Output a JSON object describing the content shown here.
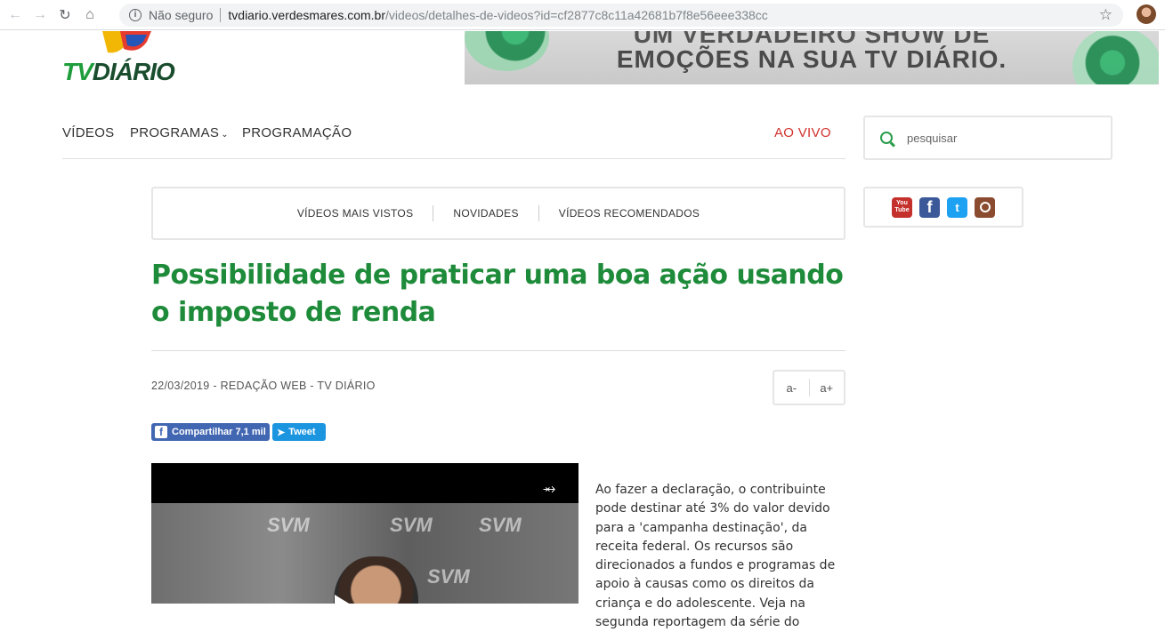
{
  "browser": {
    "security_label": "Não seguro",
    "url_host": "tvdiario.verdesmares.com.br",
    "url_path": "/videos/detalhes-de-videos?id=cf2877c8c11a42681b7f8e56eee338cc"
  },
  "logo": {
    "tv": "TV",
    "diario": "DIÁRIO"
  },
  "banner": {
    "line1": "UM VERDADEIRO SHOW DE",
    "line2": "EMOÇÕES NA SUA TV DIÁRIO."
  },
  "nav": {
    "videos": "VÍDEOS",
    "programas": "PROGRAMAS",
    "programacao": "PROGRAMAÇÃO",
    "ao_vivo": "AO VIVO"
  },
  "search": {
    "placeholder": "pesquisar"
  },
  "subnav": {
    "mais_vistos": "VÍDEOS MAIS VISTOS",
    "novidades": "NOVIDADES",
    "recomendados": "VÍDEOS RECOMENDADOS"
  },
  "social": {
    "youtube": "You Tube",
    "facebook": "f",
    "twitter": "t"
  },
  "article": {
    "title": "Possibilidade de praticar uma boa ação usando o imposto de renda",
    "byline": "22/03/2019 - REDAÇÃO WEB - TV DIÁRIO",
    "font_minus": "a-",
    "font_plus": "a+",
    "share_label": "Compartilhar 7,1 mil",
    "tweet_label": "Tweet",
    "body": "Ao fazer a declaração, o contribuinte pode destinar até 3% do valor devido para a 'campanha destinação', da receita federal. Os recursos são direcionados a fundos e programas de apoio à causas como os direitos da criança e do adolescente. Veja na segunda reportagem da série do"
  },
  "video": {
    "watermark": "SVM"
  },
  "colors": {
    "brand_green": "#1e8b3a",
    "live_red": "#d0312d",
    "facebook": "#4267b2",
    "twitter": "#1b95e0"
  }
}
